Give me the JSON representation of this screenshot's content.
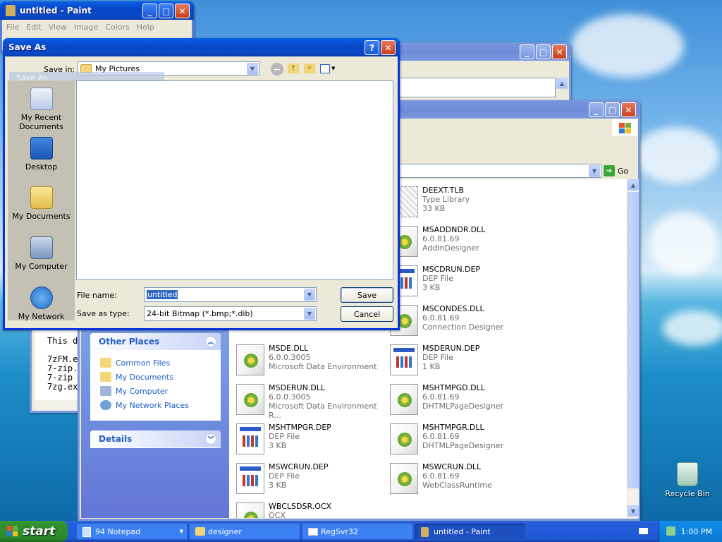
{
  "paint": {
    "title": "untitled - Paint",
    "menu": [
      "File",
      "Edit",
      "View",
      "Image",
      "Colors",
      "Help"
    ],
    "ghost_label": "Save As..."
  },
  "notepad": {
    "lines": [
      "This d",
      "",
      "7zFM.e",
      "7-zip.",
      "7-zip",
      "7zg.ex"
    ]
  },
  "explorer": {
    "go_label": "Go",
    "other_places": {
      "title": "Other Places",
      "items": [
        "Common Files",
        "My Documents",
        "My Computer",
        "My Network Places"
      ]
    },
    "details": {
      "title": "Details"
    },
    "files": [
      {
        "name": "DEEXT.TLB",
        "line2": "Type Library",
        "line3": "33 KB",
        "icon": "typelib-icon"
      },
      {
        "name": "MSADDNDR.DLL",
        "line2": "6.0.81.69",
        "line3": "AddInDesigner",
        "icon": "dll-icon"
      },
      {
        "name": "MSCDRUN.DEP",
        "line2": "DEP File",
        "line3": "3 KB",
        "icon": "dep-icon"
      },
      {
        "name": "MSCONDES.DLL",
        "line2": "6.0.81.69",
        "line3": "Connection Designer",
        "icon": "dll-icon"
      },
      {
        "name": "MSDE.DLL",
        "line2": "6.0.0.3005",
        "line3": "Microsoft Data Environment",
        "icon": "dll-icon"
      },
      {
        "name": "MSDERUN.DEP",
        "line2": "DEP File",
        "line3": "1 KB",
        "icon": "dep-icon"
      },
      {
        "name": "MSDERUN.DLL",
        "line2": "6.0.0.3005",
        "line3": "Microsoft Data Environment R...",
        "icon": "dll-icon"
      },
      {
        "name": "MSHTMPGD.DLL",
        "line2": "6.0.81.69",
        "line3": "DHTMLPageDesigner",
        "icon": "dll-icon"
      },
      {
        "name": "MSHTMPGR.DEP",
        "line2": "DEP File",
        "line3": "3 KB",
        "icon": "dep-icon"
      },
      {
        "name": "MSHTMPGR.DLL",
        "line2": "6.0.81.69",
        "line3": "DHTMLPageDesigner",
        "icon": "dll-icon"
      },
      {
        "name": "MSWCRUN.DEP",
        "line2": "DEP File",
        "line3": "3 KB",
        "icon": "dep-icon"
      },
      {
        "name": "MSWCRUN.DLL",
        "line2": "6.0.81.69",
        "line3": "WebClassRuntime",
        "icon": "dll-icon"
      },
      {
        "name": "WBCLSDSR.OCX",
        "line2": "OCX",
        "line3": "",
        "icon": "dll-icon"
      }
    ]
  },
  "saveas": {
    "title": "Save As",
    "save_in_label": "Save in:",
    "save_in_value": "My Pictures",
    "places": [
      "My Recent Documents",
      "Desktop",
      "My Documents",
      "My Computer",
      "My Network"
    ],
    "file_name_label": "File name:",
    "file_name_value": "untitled",
    "save_type_label": "Save as type:",
    "save_type_value": "24-bit Bitmap (*.bmp;*.dib)",
    "save_button": "Save",
    "cancel_button": "Cancel"
  },
  "desktop": {
    "recycle_bin": "Recycle Bin"
  },
  "taskbar": {
    "start": "start",
    "items": [
      "94 Notepad",
      "designer",
      "RegSvr32",
      "untitled - Paint"
    ],
    "clock": "1:00 PM"
  }
}
